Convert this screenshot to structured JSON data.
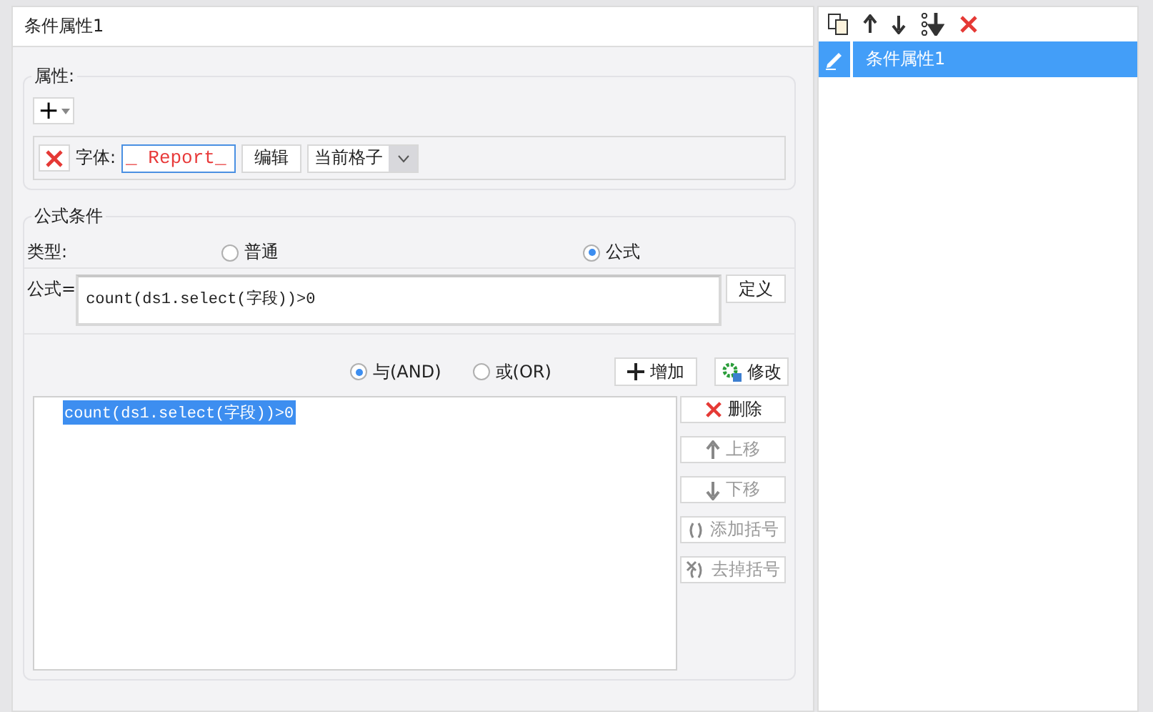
{
  "dialog": {
    "title": "条件属性1"
  },
  "attributes": {
    "legend": "属性:",
    "add_button": "+",
    "rows": [
      {
        "kind": "font",
        "label": "字体:",
        "value": "_ Report_",
        "edit_button": "编辑",
        "scope": "当前格子"
      }
    ]
  },
  "condition": {
    "legend": "公式条件",
    "type_label": "类型:",
    "types": [
      {
        "label": "普通",
        "selected": false
      },
      {
        "label": "公式",
        "selected": true
      }
    ],
    "formula_label": "公式=",
    "formula": "count(ds1.select(字段))>0",
    "define_button": "定义",
    "logic": [
      {
        "label": "与(AND)",
        "selected": true
      },
      {
        "label": "或(OR)",
        "selected": false
      }
    ],
    "add_button": "增加",
    "modify_button": "修改",
    "conditions": [
      {
        "text": "count(ds1.select(字段))>0",
        "selected": true
      }
    ],
    "actions": [
      {
        "kind": "delete",
        "label": "删除",
        "disabled": false
      },
      {
        "kind": "up",
        "label": "上移",
        "disabled": true
      },
      {
        "kind": "down",
        "label": "下移",
        "disabled": true
      },
      {
        "kind": "add-bracket",
        "label": "添加括号",
        "disabled": true
      },
      {
        "kind": "remove-bracket",
        "label": "去掉括号",
        "disabled": true
      }
    ]
  },
  "side_list": {
    "items": [
      {
        "label": "条件属性1",
        "selected": true
      }
    ]
  }
}
